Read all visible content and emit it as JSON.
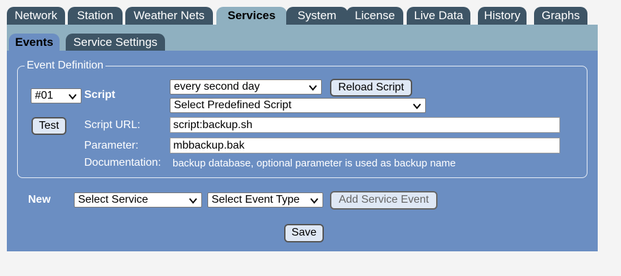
{
  "tabs": [
    {
      "label": "Network",
      "active": false
    },
    {
      "label": "Station",
      "active": false
    },
    {
      "label": "Weather Nets",
      "active": false
    },
    {
      "label": "Services",
      "active": true
    },
    {
      "label": "System",
      "active": false
    },
    {
      "label": "License",
      "active": false
    },
    {
      "label": "Live Data",
      "active": false
    },
    {
      "label": "History",
      "active": false
    },
    {
      "label": "Graphs",
      "active": false
    }
  ],
  "subtabs": [
    {
      "label": "Events",
      "active": true
    },
    {
      "label": "Service Settings",
      "active": false
    }
  ],
  "event_definition": {
    "legend": "Event Definition",
    "event_number": "#01",
    "script_label": "Script",
    "schedule": "every second day",
    "reload_button": "Reload Script",
    "predefined_script": "Select Predefined Script",
    "test_button": "Test",
    "script_url_label": "Script URL:",
    "script_url_value": "script:backup.sh",
    "parameter_label": "Parameter:",
    "parameter_value": "mbbackup.bak",
    "documentation_label": "Documentation:",
    "documentation_text": "backup database, optional parameter is used as backup name"
  },
  "new_event": {
    "label": "New",
    "service_select": "Select Service",
    "event_type_select": "Select Event Type",
    "add_button": "Add Service Event"
  },
  "save_button": "Save",
  "colors": {
    "tab_dark": "#3e5566",
    "tab_active": "#8fb0c0",
    "panel": "#6b8ec2",
    "button": "#dfe8f5"
  }
}
